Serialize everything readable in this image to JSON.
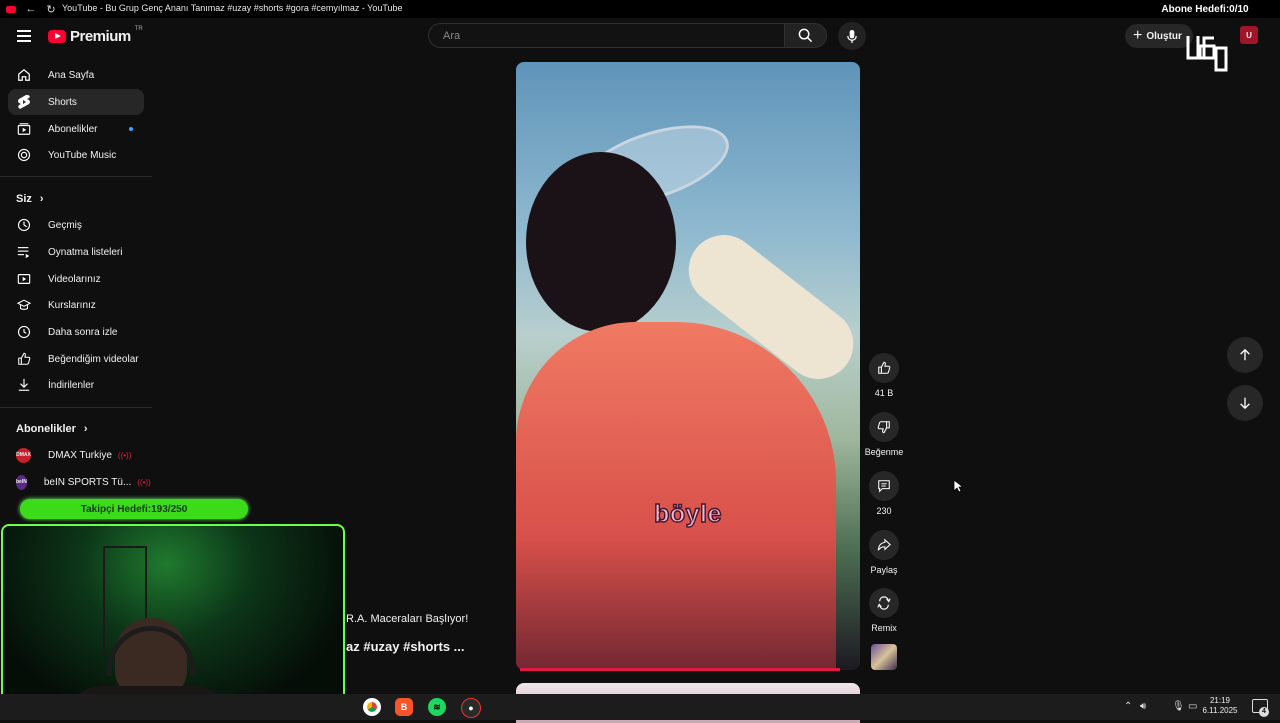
{
  "window": {
    "title": "YouTube - Bu Grup Genç Ananı Tanımaz #uzay #shorts #gora #cemyılmaz - YouTube"
  },
  "masthead": {
    "logo_text": "Premium",
    "country_code": "TR",
    "search_placeholder": "Ara",
    "create_label": "Oluştur"
  },
  "stream_overlay": {
    "subscriber_goal": "Abone Hedefi:0/10",
    "follower_goal": "Takipçi Hedefi:193/250"
  },
  "sidebar": {
    "main": [
      {
        "label": "Ana Sayfa",
        "icon": "home-icon"
      },
      {
        "label": "Shorts",
        "icon": "shorts-icon"
      },
      {
        "label": "Abonelikler",
        "icon": "subscriptions-icon"
      },
      {
        "label": "YouTube Music",
        "icon": "music-icon"
      }
    ],
    "you_heading": "Siz",
    "you_items": [
      {
        "label": "Geçmiş",
        "icon": "history-icon"
      },
      {
        "label": "Oynatma listeleri",
        "icon": "playlists-icon"
      },
      {
        "label": "Videolarınız",
        "icon": "your-videos-icon"
      },
      {
        "label": "Kurslarınız",
        "icon": "courses-icon"
      },
      {
        "label": "Daha sonra izle",
        "icon": "watch-later-icon"
      },
      {
        "label": "Beğendiğim videolar",
        "icon": "liked-icon"
      },
      {
        "label": "İndirilenler",
        "icon": "downloads-icon"
      }
    ],
    "subs_heading": "Abonelikler",
    "channels": [
      {
        "label": "DMAX Turkiye",
        "avatar_text": "DMAX",
        "color": "#c8202a"
      },
      {
        "label": "beIN SPORTS Tü...",
        "avatar_text": "beIN",
        "color": "#5b2a86"
      }
    ]
  },
  "short": {
    "caption": "böyle",
    "title_line1": "R.A. Maceraları Başlıyor!",
    "title_line2": "az #uzay #shorts ...",
    "actions": {
      "like_count": "41 B",
      "dislike_label": "Beğenme",
      "comment_count": "230",
      "share_label": "Paylaş",
      "remix_label": "Remix"
    }
  },
  "taskbar": {
    "time": "21:19",
    "date": "6.11.2025",
    "notification_count": "4"
  },
  "colors": {
    "accent_red": "#ff0033",
    "goal_green": "#3bdb1a",
    "progress": "#e01a45"
  }
}
